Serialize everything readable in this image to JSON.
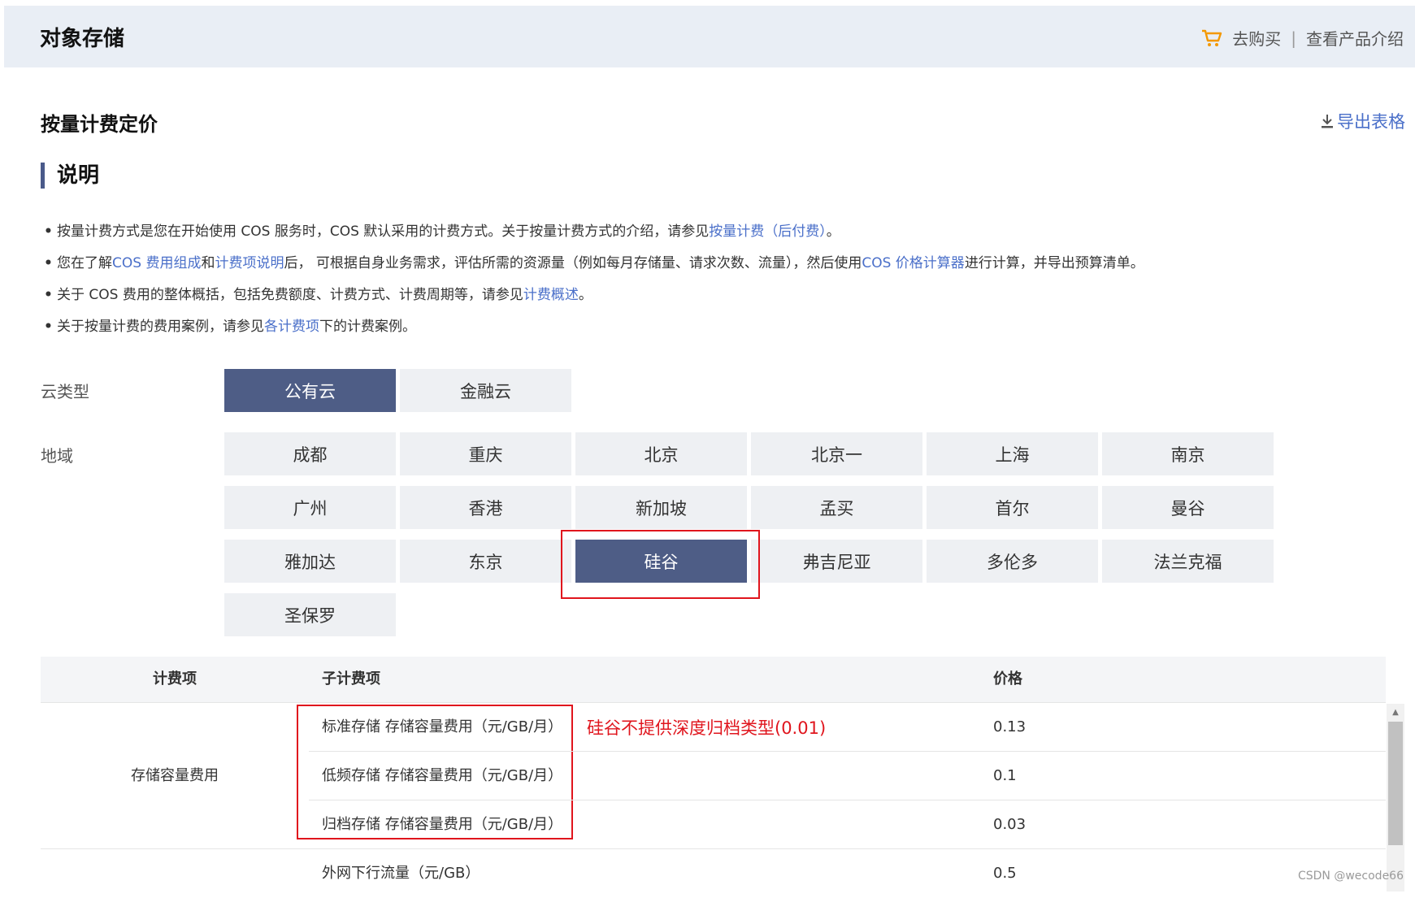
{
  "app": {
    "title": "对象存储"
  },
  "top_actions": {
    "buy": "去购买",
    "separator": "|",
    "product_intro": "查看产品介绍"
  },
  "section": {
    "title": "按量计费定价",
    "export": "导出表格"
  },
  "description": {
    "heading": "说明",
    "notes": [
      {
        "parts": [
          {
            "t": "按量计费方式是您在开始使用 COS 服务时，COS 默认采用的计费方式。关于按量计费方式的介绍，请参见"
          },
          {
            "t": "按量计费（后付费）",
            "link": true
          },
          {
            "t": "。"
          }
        ]
      },
      {
        "parts": [
          {
            "t": "您在了解"
          },
          {
            "t": "COS 费用组成",
            "link": true
          },
          {
            "t": "和"
          },
          {
            "t": "计费项说明",
            "link": true
          },
          {
            "t": "后， 可根据自身业务需求，评估所需的资源量（例如每月存储量、请求次数、流量），然后使用"
          },
          {
            "t": "COS 价格计算器",
            "link": true
          },
          {
            "t": "进行计算，并导出预算清单。"
          }
        ]
      },
      {
        "parts": [
          {
            "t": "关于 COS 费用的整体概括，包括免费额度、计费方式、计费周期等，请参见"
          },
          {
            "t": "计费概述",
            "link": true
          },
          {
            "t": "。"
          }
        ]
      },
      {
        "parts": [
          {
            "t": "关于按量计费的费用案例，请参见"
          },
          {
            "t": "各计费项",
            "link": true
          },
          {
            "t": "下的计费案例。"
          }
        ]
      }
    ]
  },
  "cloud_type": {
    "label": "云类型",
    "options": [
      {
        "label": "公有云",
        "selected": true
      },
      {
        "label": "金融云",
        "selected": false
      }
    ]
  },
  "region": {
    "label": "地域",
    "options": [
      {
        "label": "成都",
        "selected": false
      },
      {
        "label": "重庆",
        "selected": false
      },
      {
        "label": "北京",
        "selected": false
      },
      {
        "label": "北京一",
        "selected": false
      },
      {
        "label": "上海",
        "selected": false
      },
      {
        "label": "南京",
        "selected": false
      },
      {
        "label": "广州",
        "selected": false
      },
      {
        "label": "香港",
        "selected": false
      },
      {
        "label": "新加坡",
        "selected": false
      },
      {
        "label": "孟买",
        "selected": false
      },
      {
        "label": "首尔",
        "selected": false
      },
      {
        "label": "曼谷",
        "selected": false
      },
      {
        "label": "雅加达",
        "selected": false
      },
      {
        "label": "东京",
        "selected": false
      },
      {
        "label": "硅谷",
        "selected": true
      },
      {
        "label": "弗吉尼亚",
        "selected": false
      },
      {
        "label": "多伦多",
        "selected": false
      },
      {
        "label": "法兰克福",
        "selected": false
      },
      {
        "label": "圣保罗",
        "selected": false
      }
    ]
  },
  "annotation": {
    "text": "硅谷不提供深度归档类型(0.01)"
  },
  "table": {
    "headers": {
      "item": "计费项",
      "sub_item": "子计费项",
      "price": "价格"
    },
    "groups": [
      {
        "item": "存储容量费用",
        "rows": [
          {
            "sub_item": "标准存储 存储容量费用（元/GB/月）",
            "price": "0.13"
          },
          {
            "sub_item": "低频存储 存储容量费用（元/GB/月）",
            "price": "0.1"
          },
          {
            "sub_item": "归档存储 存储容量费用（元/GB/月）",
            "price": "0.03"
          }
        ]
      },
      {
        "item": "",
        "rows": [
          {
            "sub_item": "外网下行流量（元/GB）",
            "price": "0.5"
          }
        ]
      }
    ]
  },
  "watermark": "CSDN @wecode66",
  "colors": {
    "accent": "#4e5d86",
    "link": "#4a6fc9",
    "annotation": "#e0151d",
    "cart": "#f39800"
  }
}
